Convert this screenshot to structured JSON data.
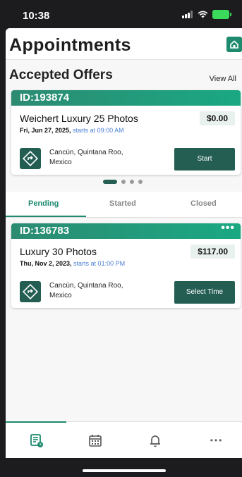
{
  "status_bar": {
    "time": "10:38"
  },
  "header": {
    "title": "Appointments"
  },
  "accepted": {
    "section_title": "Accepted Offers",
    "view_all": "View All",
    "card": {
      "id": "ID:193874",
      "name": "Weichert Luxury 25 Photos",
      "date": "Fri, Jun 27, 2025,",
      "starts": "starts at 09:00 AM",
      "price": "$0.00",
      "address_line1": "Cancún, Quintana Roo,",
      "address_line2": "Mexico",
      "action": "Start"
    }
  },
  "tabs": [
    {
      "label": "Pending"
    },
    {
      "label": "Started"
    },
    {
      "label": "Closed"
    }
  ],
  "pending_card": {
    "id": "ID:136783",
    "more": "•••",
    "name": "Luxury 30 Photos",
    "date": "Thu, Nov 2, 2023,",
    "starts": "starts at 01:00 PM",
    "price": "$117.00",
    "address_line1": "Cancún, Quintana Roo,",
    "address_line2": "Mexico",
    "action": "Select Time"
  },
  "nav_more": "•••",
  "colors": {
    "accent": "#1e8a6e",
    "dark_green": "#245e52",
    "link_blue": "#4a7fd4"
  }
}
